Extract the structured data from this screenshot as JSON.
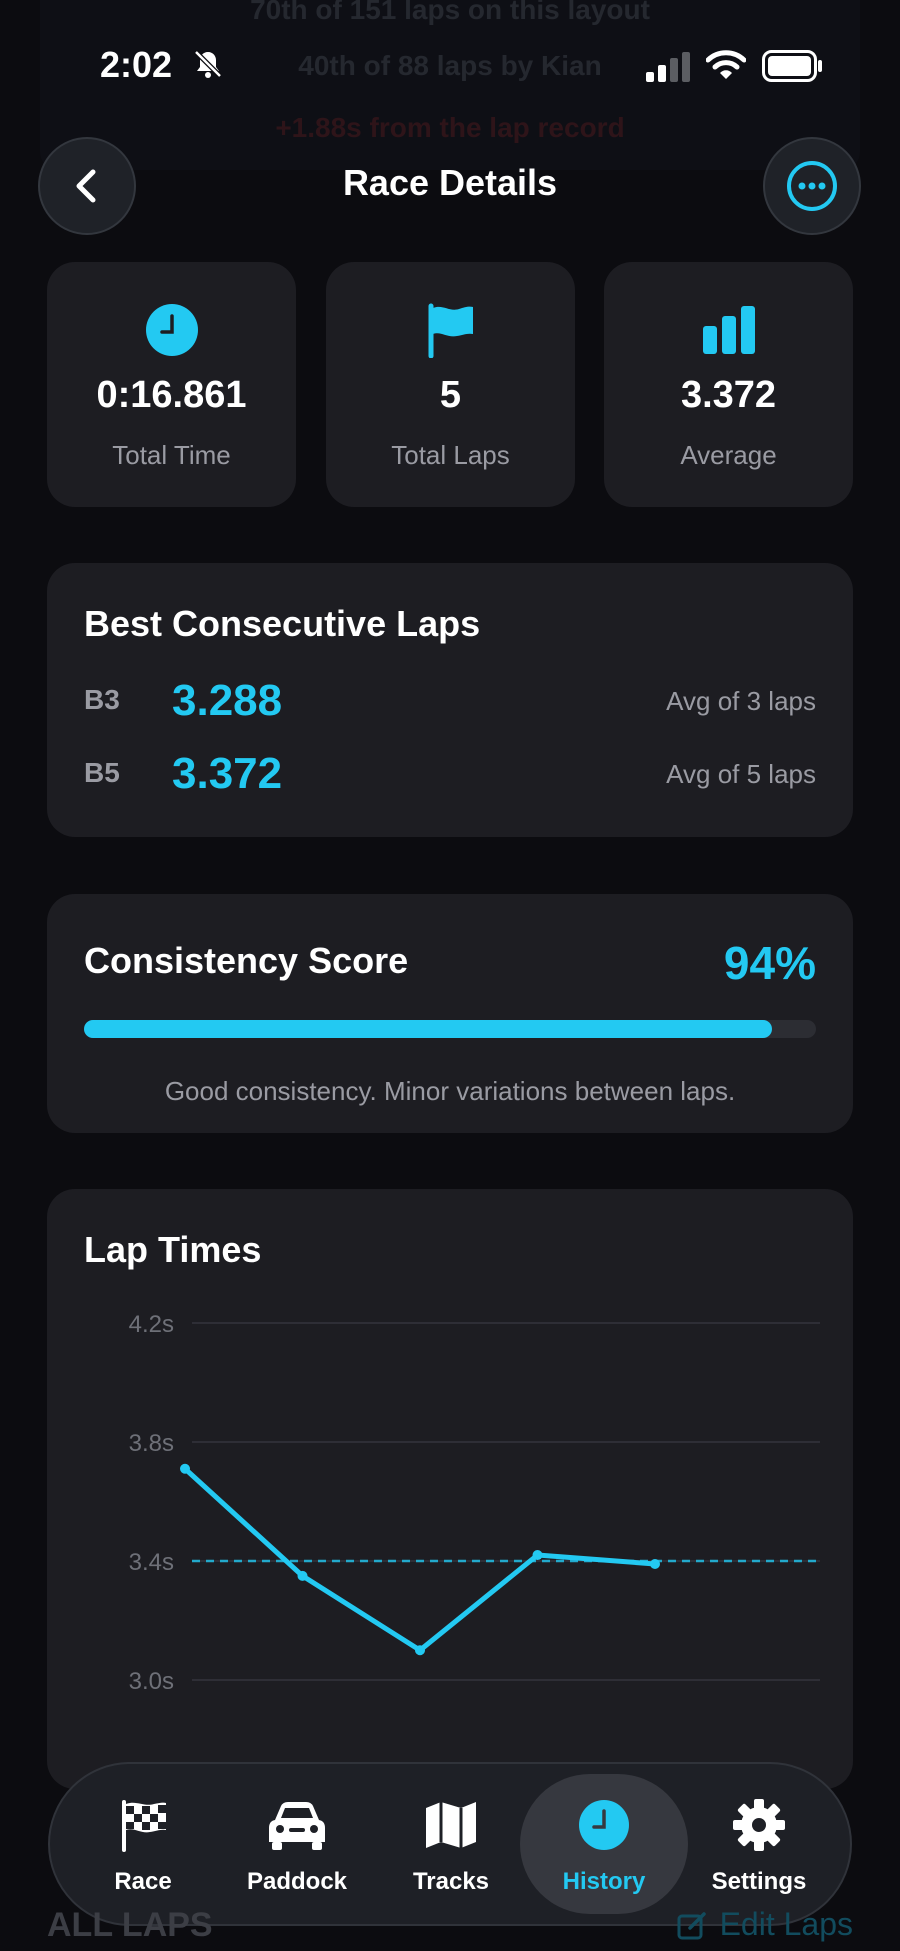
{
  "background": {
    "line1": "70th of 151 laps on this layout",
    "line2": "40th of 88 laps by Kian",
    "line3_delta": "+1.88s",
    "line3_text": "from the lap record"
  },
  "status_bar": {
    "time": "2:02"
  },
  "header": {
    "title": "Race Details"
  },
  "stats": [
    {
      "icon": "clock-icon",
      "value": "0:16.861",
      "label": "Total Time"
    },
    {
      "icon": "flag-icon",
      "value": "5",
      "label": "Total Laps"
    },
    {
      "icon": "bar-chart-icon",
      "value": "3.372",
      "label": "Average"
    }
  ],
  "best_consecutive": {
    "title": "Best Consecutive Laps",
    "rows": [
      {
        "key": "B3",
        "value": "3.288",
        "note": "Avg of 3 laps"
      },
      {
        "key": "B5",
        "value": "3.372",
        "note": "Avg of 5 laps"
      }
    ]
  },
  "consistency": {
    "title": "Consistency Score",
    "score_label": "94%",
    "score": 0.94,
    "description": "Good consistency. Minor variations between laps."
  },
  "chart_data": {
    "type": "line",
    "title": "Lap Times",
    "x": [
      1,
      2,
      3,
      4,
      5
    ],
    "series": [
      {
        "values": [
          3.71,
          3.35,
          3.1,
          3.42,
          3.39
        ]
      }
    ],
    "reference_line": 3.4,
    "yticks": [
      3.0,
      3.4,
      3.8,
      4.2
    ],
    "ytick_labels": [
      "3.0s",
      "3.4s",
      "3.8s",
      "4.2s"
    ],
    "ylim": [
      2.6,
      4.2
    ],
    "grid": true,
    "accent_color": "#23c9f2"
  },
  "tabs": [
    {
      "icon": "checkered-flag-icon",
      "label": "Race",
      "active": false
    },
    {
      "icon": "car-icon",
      "label": "Paddock",
      "active": false
    },
    {
      "icon": "map-icon",
      "label": "Tracks",
      "active": false
    },
    {
      "icon": "clock-icon",
      "label": "History",
      "active": true
    },
    {
      "icon": "gear-icon",
      "label": "Settings",
      "active": false
    }
  ],
  "footer": {
    "section_title": "ALL LAPS",
    "edit_label": "Edit Laps"
  }
}
